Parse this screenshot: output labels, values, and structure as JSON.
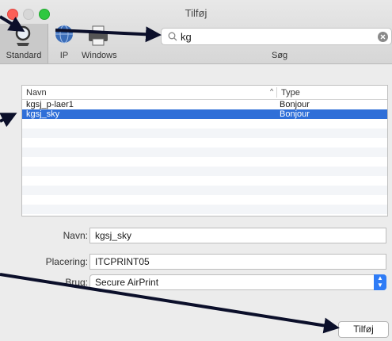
{
  "window": {
    "title": "Tilføj"
  },
  "toolbar": {
    "tabs": [
      {
        "label": "Standard",
        "icon": "magnifier-icon"
      },
      {
        "label": "IP",
        "icon": "globe-icon"
      },
      {
        "label": "Windows",
        "icon": "printer-icon"
      }
    ],
    "search": {
      "value": "kg",
      "label": "Søg"
    }
  },
  "list": {
    "columns": {
      "name": "Navn",
      "type": "Type"
    },
    "rows": [
      {
        "name": "kgsj_p-laer1",
        "type": "Bonjour",
        "selected": false
      },
      {
        "name": "kgsj_sky",
        "type": "Bonjour",
        "selected": true
      }
    ]
  },
  "form": {
    "name_label": "Navn:",
    "name_value": "kgsj_sky",
    "location_label": "Placering:",
    "location_value": "ITCPRINT05",
    "use_label": "Brug:",
    "use_value": "Secure AirPrint"
  },
  "footer": {
    "add_label": "Tilføj"
  },
  "colors": {
    "selection": "#2f6fd8",
    "accent": "#2f7cf6",
    "annotation_arrow": "#0b0f2a"
  }
}
